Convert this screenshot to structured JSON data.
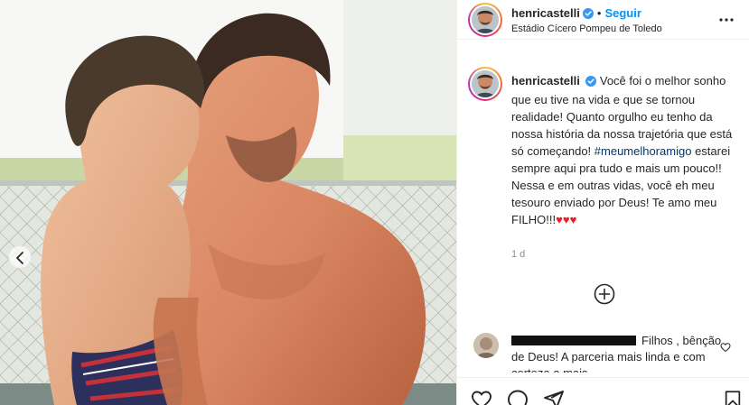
{
  "post": {
    "username": "henricastelli",
    "follow_label": "Seguir",
    "separator": "•",
    "location": "Estádio Cícero Pompeu de Toledo",
    "caption_text_1": "Você foi o melhor sonho que eu tive na vida e que se tornou realidade! Quanto orgulho eu tenho da nossa história da nossa trajetória que está só começando! ",
    "hashtag": "#meumelhoramigo",
    "caption_text_2": " estarei sempre aqui pra tudo e mais um pouco!! Nessa e em outras vidas, você eh meu tesouro enviado por Deus! Te amo meu FILHO!!!",
    "hearts": "♥♥♥",
    "age": "1 d"
  },
  "comment": {
    "text": "Filhos , bênção de Deus! A parceria mais linda e com certeza a mais"
  },
  "icons": {
    "verified": "verified-badge-icon",
    "more": "more-options-icon",
    "add": "add-comment-plus-icon",
    "like": "heart-icon",
    "comment": "comment-bubble-icon",
    "share": "paper-plane-icon",
    "save": "bookmark-icon",
    "prev": "chevron-left-icon"
  },
  "colors": {
    "link_blue": "#0095f6",
    "hashtag": "#00376b",
    "heart_red": "#ed1c24",
    "muted": "#8e8e8e"
  }
}
